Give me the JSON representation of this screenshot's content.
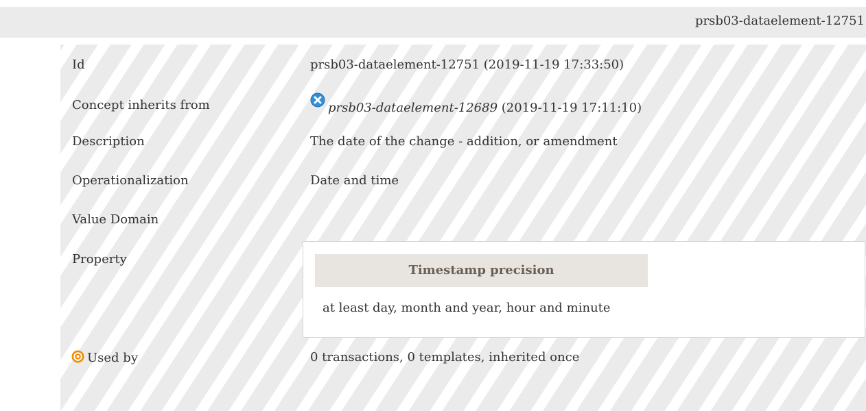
{
  "header": {
    "title": "prsb03-dataelement-12751"
  },
  "rows": {
    "id": {
      "label": "Id",
      "value": "prsb03-dataelement-12751 (2019-11-19 17:33:50)"
    },
    "inherits": {
      "label": "Concept inherits from",
      "icon": "x-circle-icon",
      "link": "prsb03-dataelement-12689",
      "suffix": " (2019-11-19 17:11:10)"
    },
    "description": {
      "label": "Description",
      "value": "The date of the change - addition, or amendment"
    },
    "operationalization": {
      "label": "Operationalization",
      "value": "Date and time"
    },
    "value_domain": {
      "label": "Value Domain"
    },
    "property": {
      "label": "Property",
      "header": "Timestamp precision",
      "value": "at least day, month and year, hour and minute"
    },
    "used_by": {
      "label": "Used by",
      "icon": "target-icon",
      "value": "0 transactions, 0 templates, inherited once"
    }
  },
  "colors": {
    "header_bg": "#ebebeb",
    "stripe": "#ebebeb",
    "property_header_bg": "#e8e5e0",
    "icon_blue": "#2f8fd9",
    "icon_orange": "#f28c00"
  }
}
